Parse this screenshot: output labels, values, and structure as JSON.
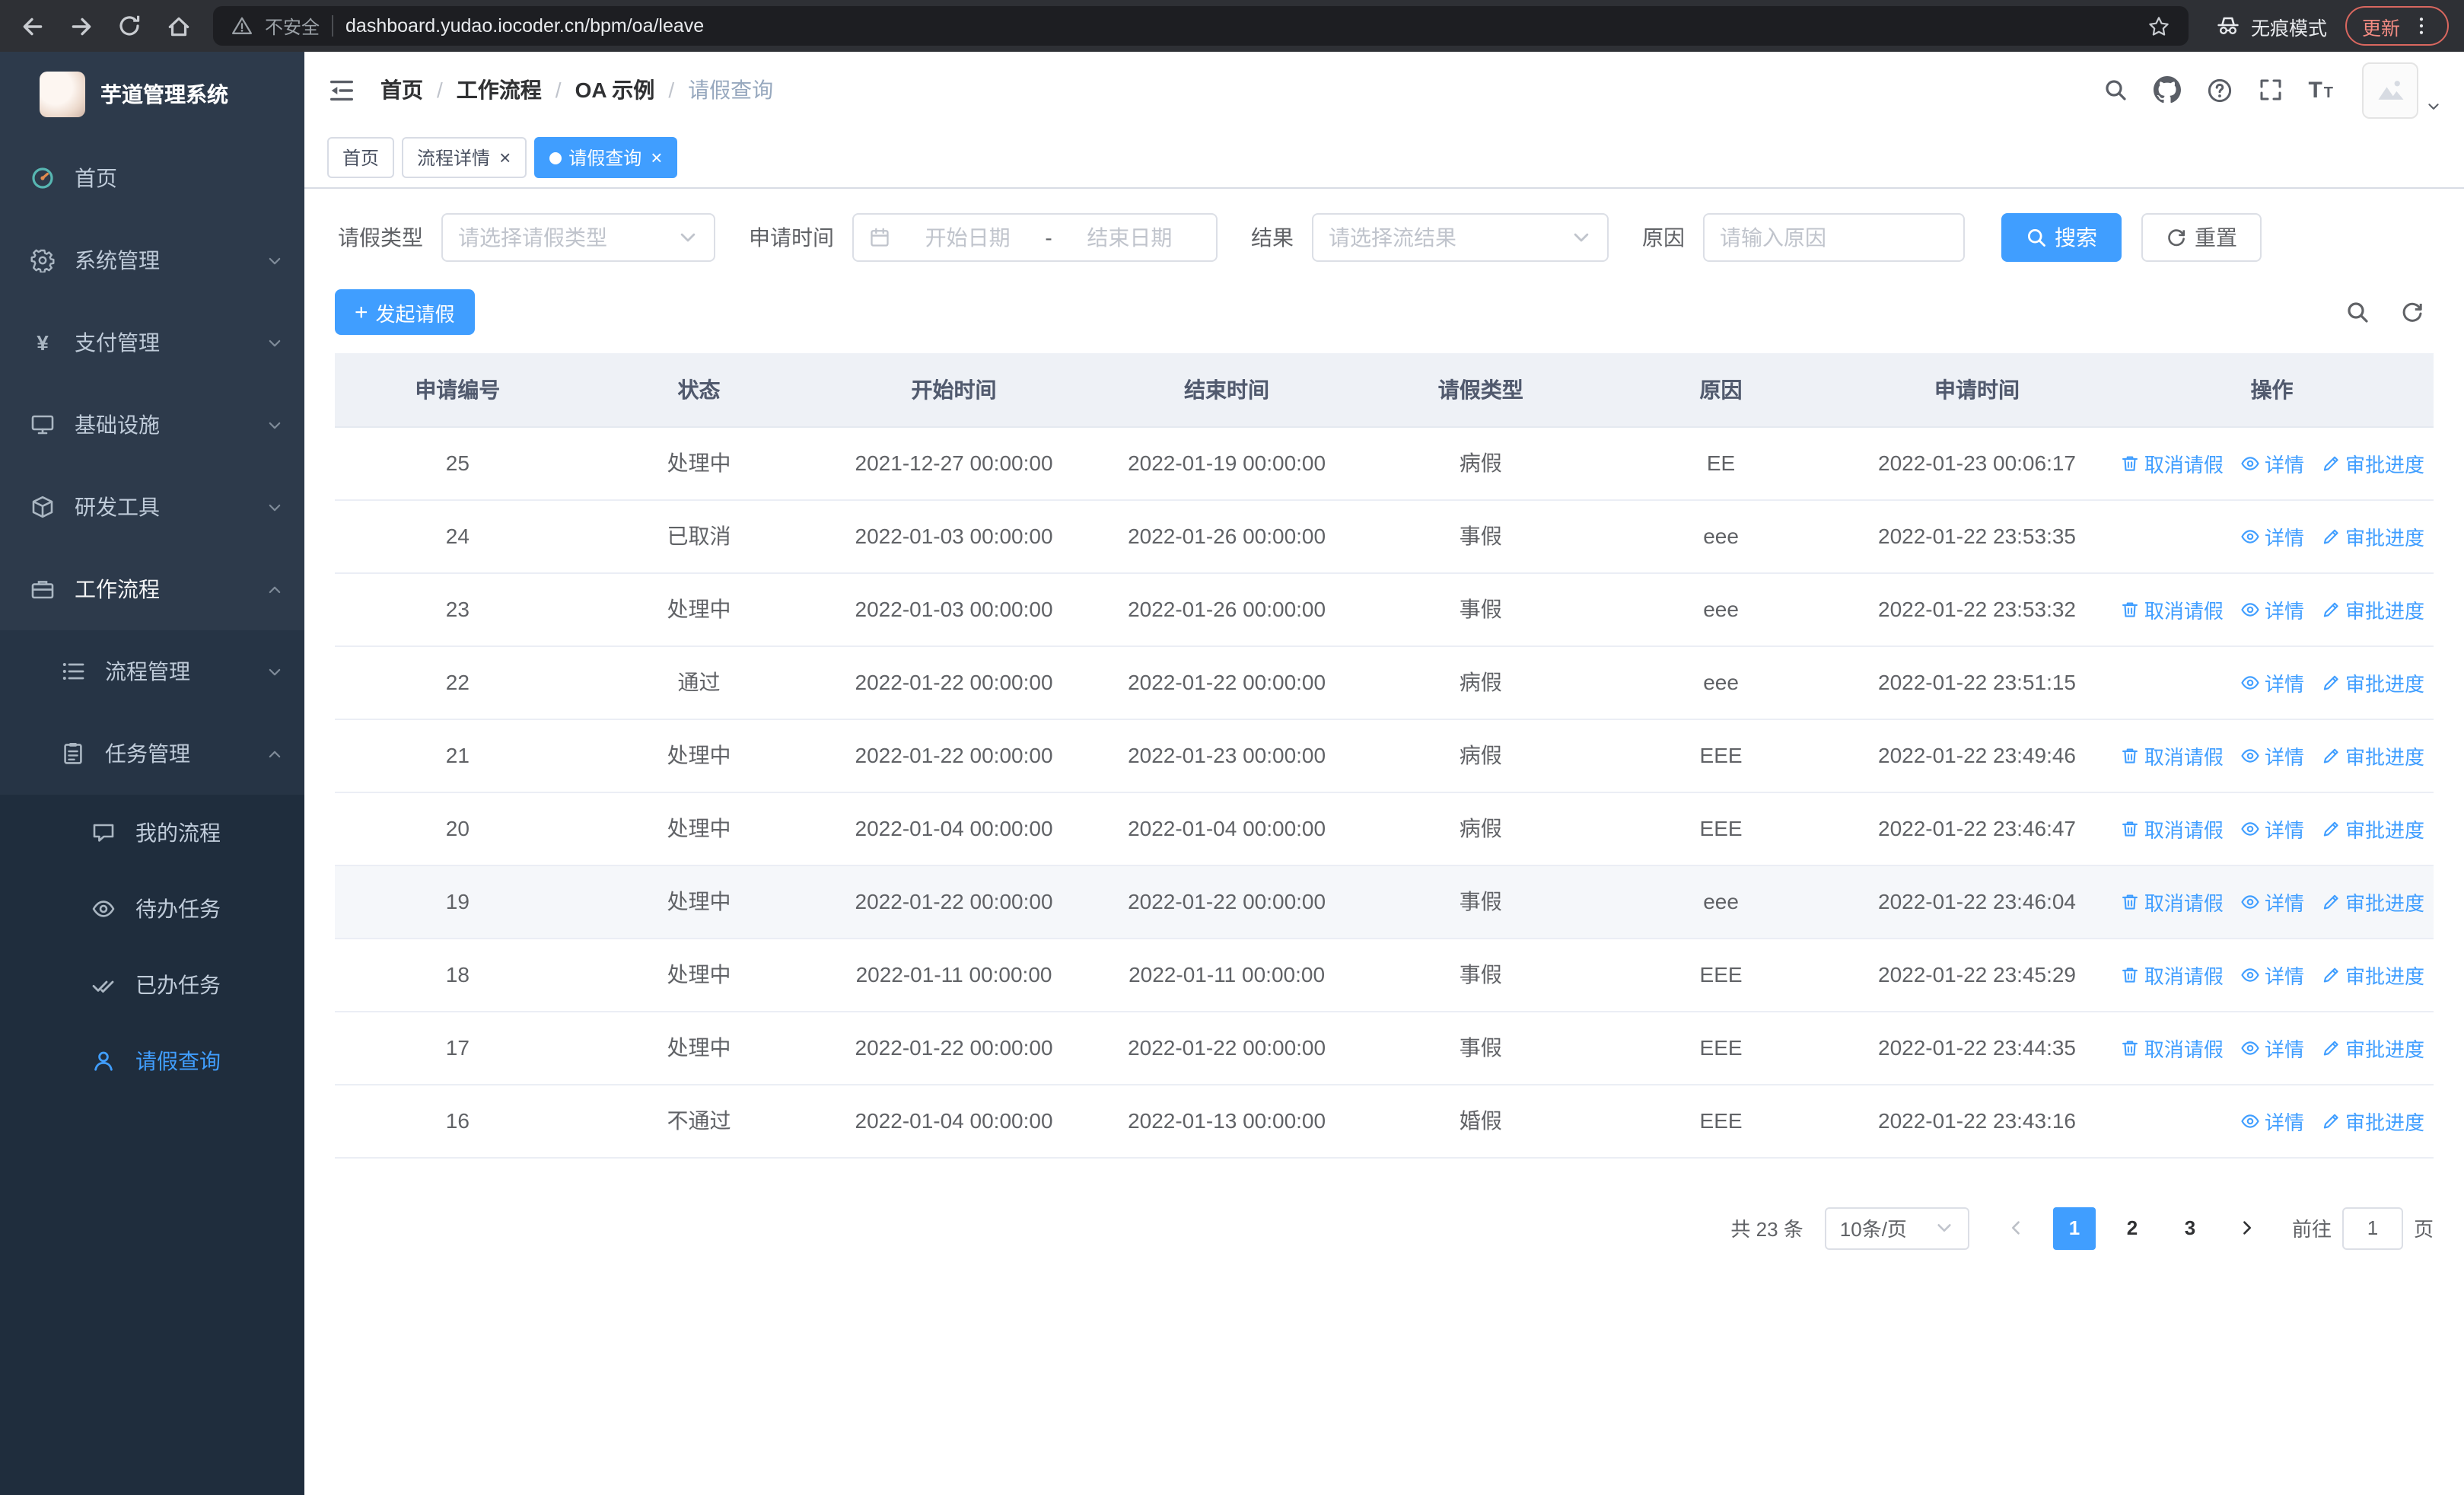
{
  "browser": {
    "security_warning": "不安全",
    "url": "dashboard.yudao.iocoder.cn/bpm/oa/leave",
    "incognito_label": "无痕模式",
    "update_label": "更新"
  },
  "sidebar": {
    "logo_title": "芋道管理系统",
    "items": [
      {
        "label": "首页"
      },
      {
        "label": "系统管理"
      },
      {
        "label": "支付管理"
      },
      {
        "label": "基础设施"
      },
      {
        "label": "研发工具"
      },
      {
        "label": "工作流程"
      },
      {
        "label": "流程管理"
      },
      {
        "label": "任务管理"
      },
      {
        "label": "我的流程"
      },
      {
        "label": "待办任务"
      },
      {
        "label": "已办任务"
      },
      {
        "label": "请假查询"
      }
    ]
  },
  "header": {
    "breadcrumb": [
      "首页",
      "工作流程",
      "OA 示例",
      "请假查询"
    ]
  },
  "tabs": [
    {
      "label": "首页"
    },
    {
      "label": "流程详情"
    },
    {
      "label": "请假查询"
    }
  ],
  "filters": {
    "leave_type_label": "请假类型",
    "leave_type_placeholder": "请选择请假类型",
    "apply_time_label": "申请时间",
    "start_date_placeholder": "开始日期",
    "date_separator": "-",
    "end_date_placeholder": "结束日期",
    "result_label": "结果",
    "result_placeholder": "请选择流结果",
    "reason_label": "原因",
    "reason_placeholder": "请输入原因",
    "search_button": "搜索",
    "reset_button": "重置"
  },
  "toolbar": {
    "create_button": "发起请假"
  },
  "table": {
    "columns": [
      "申请编号",
      "状态",
      "开始时间",
      "结束时间",
      "请假类型",
      "原因",
      "申请时间",
      "操作"
    ],
    "actions": {
      "cancel": "取消请假",
      "detail": "详情",
      "progress": "审批进度"
    },
    "rows": [
      {
        "id": "25",
        "status": "处理中",
        "start": "2021-12-27 00:00:00",
        "end": "2022-01-19 00:00:00",
        "type": "病假",
        "reason": "EE",
        "applied": "2022-01-23 00:06:17"
      },
      {
        "id": "24",
        "status": "已取消",
        "start": "2022-01-03 00:00:00",
        "end": "2022-01-26 00:00:00",
        "type": "事假",
        "reason": "eee",
        "applied": "2022-01-22 23:53:35"
      },
      {
        "id": "23",
        "status": "处理中",
        "start": "2022-01-03 00:00:00",
        "end": "2022-01-26 00:00:00",
        "type": "事假",
        "reason": "eee",
        "applied": "2022-01-22 23:53:32"
      },
      {
        "id": "22",
        "status": "通过",
        "start": "2022-01-22 00:00:00",
        "end": "2022-01-22 00:00:00",
        "type": "病假",
        "reason": "eee",
        "applied": "2022-01-22 23:51:15"
      },
      {
        "id": "21",
        "status": "处理中",
        "start": "2022-01-22 00:00:00",
        "end": "2022-01-23 00:00:00",
        "type": "病假",
        "reason": "EEE",
        "applied": "2022-01-22 23:49:46"
      },
      {
        "id": "20",
        "status": "处理中",
        "start": "2022-01-04 00:00:00",
        "end": "2022-01-04 00:00:00",
        "type": "病假",
        "reason": "EEE",
        "applied": "2022-01-22 23:46:47"
      },
      {
        "id": "19",
        "status": "处理中",
        "start": "2022-01-22 00:00:00",
        "end": "2022-01-22 00:00:00",
        "type": "事假",
        "reason": "eee",
        "applied": "2022-01-22 23:46:04"
      },
      {
        "id": "18",
        "status": "处理中",
        "start": "2022-01-11 00:00:00",
        "end": "2022-01-11 00:00:00",
        "type": "事假",
        "reason": "EEE",
        "applied": "2022-01-22 23:45:29"
      },
      {
        "id": "17",
        "status": "处理中",
        "start": "2022-01-22 00:00:00",
        "end": "2022-01-22 00:00:00",
        "type": "事假",
        "reason": "EEE",
        "applied": "2022-01-22 23:44:35"
      },
      {
        "id": "16",
        "status": "不通过",
        "start": "2022-01-04 00:00:00",
        "end": "2022-01-13 00:00:00",
        "type": "婚假",
        "reason": "EEE",
        "applied": "2022-01-22 23:43:16"
      }
    ]
  },
  "pagination": {
    "total_text": "共 23 条",
    "page_size": "10条/页",
    "pages": [
      "1",
      "2",
      "3"
    ],
    "active_page": "1",
    "goto_label": "前往",
    "goto_value": "1",
    "goto_suffix": "页"
  },
  "colors": {
    "accent": "#409eff",
    "sidebar_bg": "#2d3a4b",
    "sidebar_submenu_bg": "#1f2d3d",
    "tab_active_bg": "#409eff"
  }
}
